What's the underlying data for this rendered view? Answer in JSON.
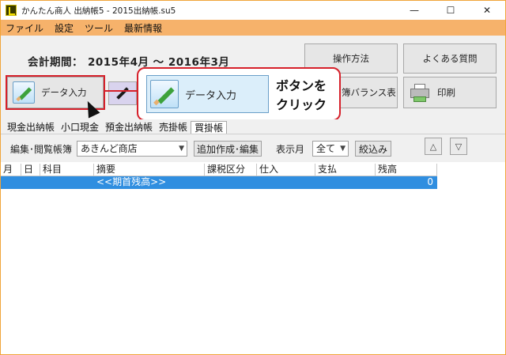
{
  "window": {
    "title": "かんたん商人 出納帳5 - 2015出納帳.su5",
    "controls": {
      "minimize": "—",
      "maximize": "☐",
      "close": "✕"
    }
  },
  "menu": {
    "items": [
      "ファイル",
      "設定",
      "ツール",
      "最新情報"
    ]
  },
  "toolbar": {
    "period_label": "会計期間：",
    "period_value": "2015年4月 〜 2016年3月",
    "ops_button": "操作方法",
    "faq_button": "よくある質問",
    "data_entry_button": "データ入力",
    "balance_button": "簿バランス表",
    "print_button": "印刷"
  },
  "callout": {
    "button_label": "データ入力",
    "instruction_line1": "ボタンを",
    "instruction_line2": "クリック"
  },
  "tabs": [
    "現金出納帳",
    "小口現金",
    "預金出納帳",
    "売掛帳",
    "買掛帳"
  ],
  "filter": {
    "ledger_label": "編集･閲覧帳簿",
    "ledger_value": "あきんど商店",
    "add_edit_button": "追加作成･編集",
    "month_label": "表示月",
    "month_value": "全て",
    "narrow_button": "絞込み",
    "up_symbol": "△",
    "down_symbol": "▽"
  },
  "table": {
    "headers": [
      "月",
      "日",
      "科目",
      "摘要",
      "課税区分",
      "仕入",
      "支払",
      "残高"
    ],
    "rows": [
      {
        "month": "",
        "day": "",
        "account": "",
        "description": "<<期首残高>>",
        "tax": "",
        "purchase": "",
        "payment": "",
        "balance": "0"
      }
    ]
  },
  "colors": {
    "menu_bar": "#f6b26b",
    "highlight_red": "#d6202a",
    "selected_row": "#2f8ee0"
  }
}
